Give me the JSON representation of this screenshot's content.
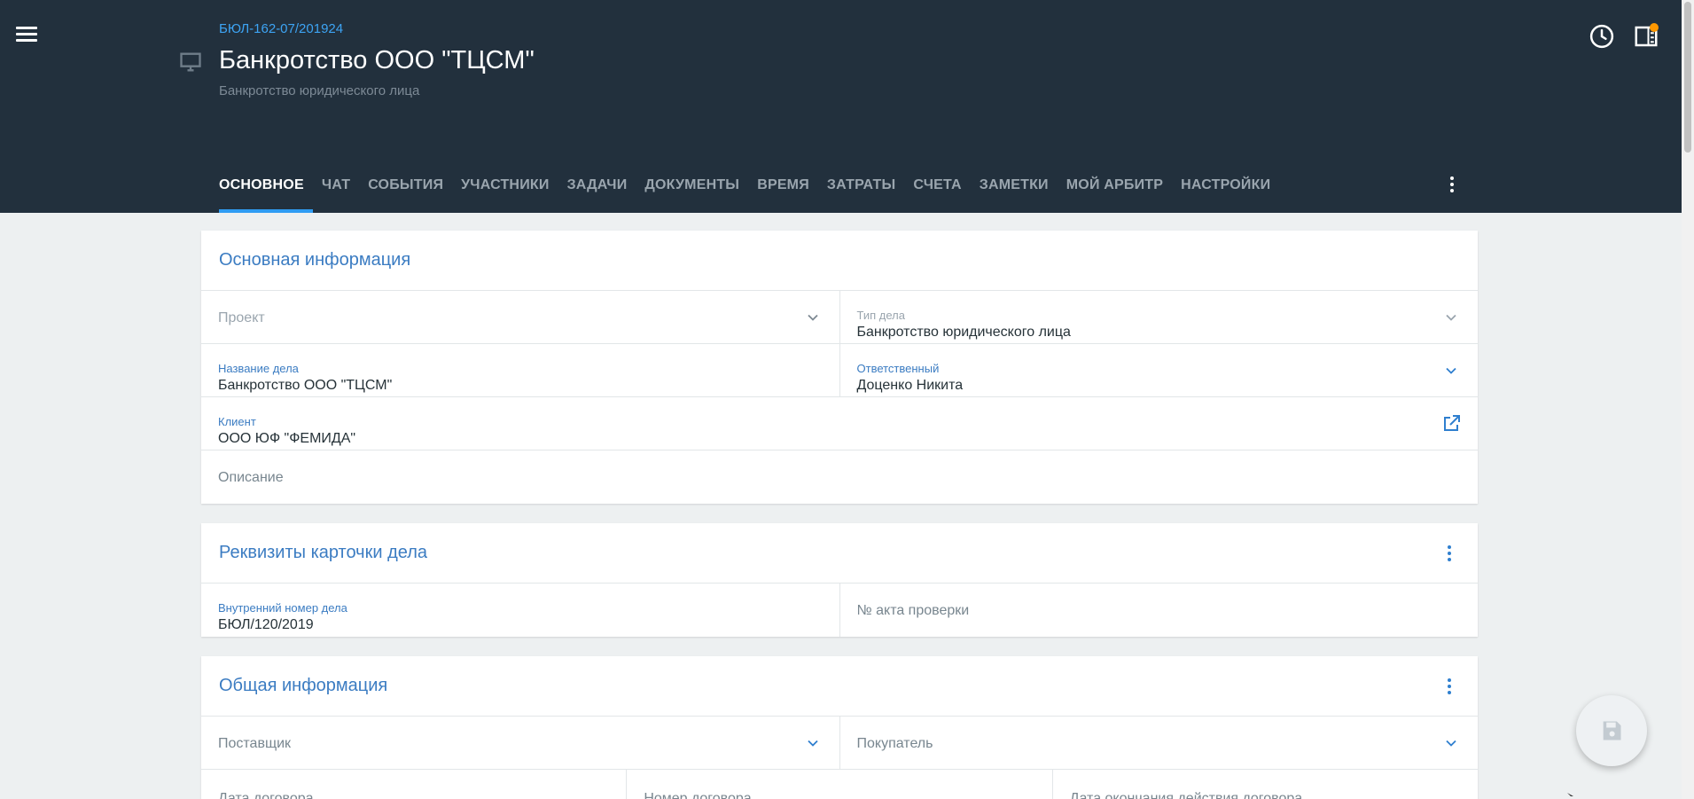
{
  "header": {
    "case_id": "БЮЛ-162-07/201924",
    "title": "Банкротство ООО \"ТЦСМ\"",
    "subtitle": "Банкротство юридического лица"
  },
  "tabs": [
    {
      "label": "ОСНОВНОЕ",
      "active": true
    },
    {
      "label": "ЧАТ"
    },
    {
      "label": "СОБЫТИЯ"
    },
    {
      "label": "УЧАСТНИКИ"
    },
    {
      "label": "ЗАДАЧИ"
    },
    {
      "label": "ДОКУМЕНТЫ"
    },
    {
      "label": "ВРЕМЯ"
    },
    {
      "label": "ЗАТРАТЫ"
    },
    {
      "label": "СЧЕТА"
    },
    {
      "label": "ЗАМЕТКИ"
    },
    {
      "label": "МОЙ АРБИТР"
    },
    {
      "label": "НАСТРОЙКИ"
    }
  ],
  "main_info": {
    "title": "Основная информация",
    "project_placeholder": "Проект",
    "case_type_label": "Тип дела",
    "case_type_value": "Банкротство юридического лица",
    "case_name_label": "Название дела",
    "case_name_value": "Банкротство ООО \"ТЦСМ\"",
    "responsible_label": "Ответственный",
    "responsible_value": "Доценко Никита",
    "client_label": "Клиент",
    "client_value": "ООО ЮФ \"ФЕМИДА\"",
    "description_placeholder": "Описание"
  },
  "requisites": {
    "title": "Реквизиты карточки дела",
    "internal_number_label": "Внутренний номер дела",
    "internal_number_value": "БЮЛ/120/2019",
    "inspection_act_placeholder": "№ акта проверки"
  },
  "general_info": {
    "title": "Общая информация",
    "supplier_placeholder": "Поставщик",
    "buyer_placeholder": "Покупатель",
    "contract_date_placeholder": "Дата договора",
    "contract_number_placeholder": "Номер договора",
    "contract_end_placeholder": "Дата окончания действия договора"
  },
  "colors": {
    "header_bg": "#22303d",
    "accent": "#2f9cf3",
    "link_blue": "#3b7cc2",
    "notification": "#ff9800"
  }
}
